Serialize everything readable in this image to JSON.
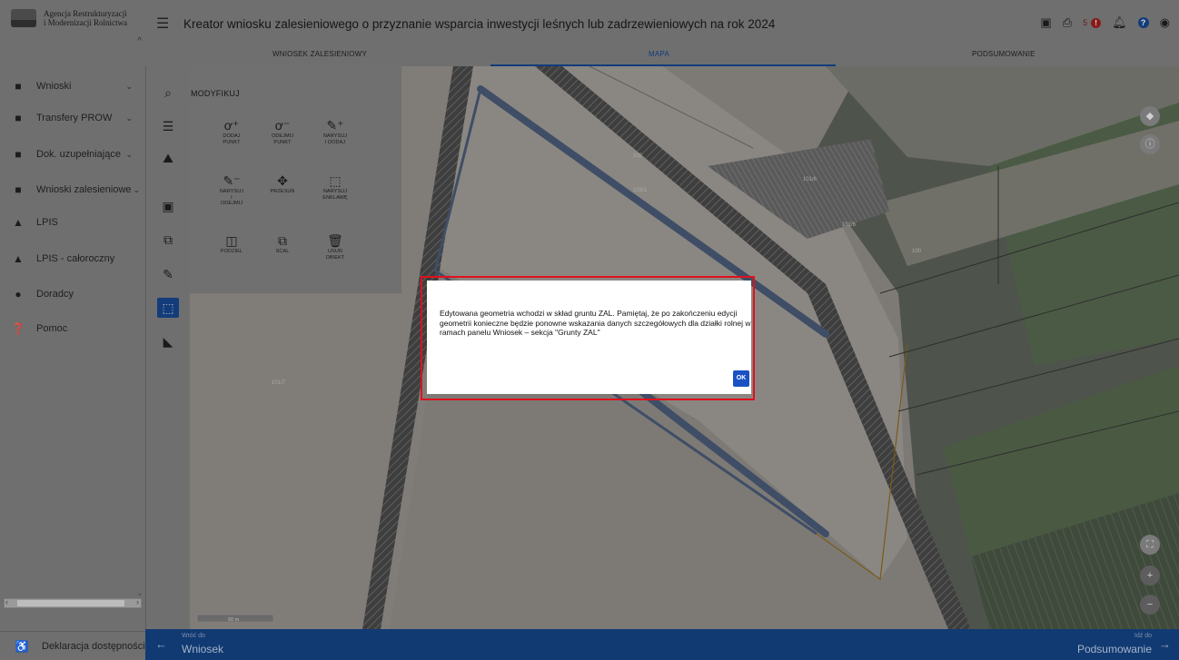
{
  "app": {
    "logo_text_line1": "Agencja Restrukturyzacji",
    "logo_text_line2": "i Modernizacji Rolnictwa",
    "title": "Kreator wniosku zalesieniowego o przyznanie wsparcia inwestycji leśnych lub zadrzewieniowych na rok  2024"
  },
  "header": {
    "save_icon": "save-icon",
    "print_icon": "print-icon",
    "notification_count": "5",
    "alert_badge": "!",
    "bell_icon": "bell-icon",
    "help_badge": "?",
    "account_icon": "account-icon"
  },
  "tabs": [
    {
      "label": "WNIOSEK ZALESIENIOWY"
    },
    {
      "label": "MAPA"
    },
    {
      "label": "PODSUMOWANIE"
    }
  ],
  "sidebar": {
    "items": [
      {
        "label": "Wnioski",
        "icon": "document-icon",
        "has_chevron": true
      },
      {
        "label": "Transfery PROW",
        "icon": "document-icon",
        "has_chevron": true
      },
      {
        "label": "Dok. uzupełniające",
        "icon": "document-icon",
        "has_chevron": true
      },
      {
        "label": "Wnioski zalesieniowe",
        "icon": "document-icon",
        "has_chevron": true
      },
      {
        "label": "LPIS",
        "icon": "mountain-icon",
        "has_chevron": false
      },
      {
        "label": "LPIS - całoroczny",
        "icon": "mountain-icon",
        "has_chevron": false
      },
      {
        "label": "Doradcy",
        "icon": "person-icon",
        "has_chevron": false
      },
      {
        "label": "Pomoc",
        "icon": "help-icon",
        "has_chevron": false
      }
    ],
    "accessibility_label": "Deklaracja dostępności"
  },
  "modify_panel": {
    "title": "MODYFIKUJ",
    "tools": [
      {
        "label": "DODAJ\nPUNKT",
        "icon": "add-point-icon"
      },
      {
        "label": "ODEJMIJ\nPUNKT",
        "icon": "remove-point-icon"
      },
      {
        "label": "NARYSUJ\nI DODAJ",
        "icon": "draw-add-icon"
      },
      {
        "label": "NARYSUJ\nI\nODEJMIJ",
        "icon": "draw-subtract-icon"
      },
      {
        "label": "PRZESUŃ",
        "icon": "move-icon"
      },
      {
        "label": "NARYSUJ\nENKLAWĘ",
        "icon": "draw-enclave-icon"
      },
      {
        "label": "PODZIEL",
        "icon": "split-icon"
      },
      {
        "label": "SCAL",
        "icon": "merge-icon"
      },
      {
        "label": "USUŃ\nOBIEKT",
        "icon": "delete-icon"
      }
    ]
  },
  "map": {
    "parcel_labels": [
      "101/6",
      "101/6",
      "100",
      "103/1",
      "101/7",
      "102"
    ],
    "scale_label": "50 m"
  },
  "bottom_nav": {
    "back_small": "Wróć do",
    "back_big": "Wniosek",
    "next_small": "Idź do",
    "next_big": "Podsumowanie"
  },
  "modal": {
    "message": "Edytowana geometria wchodzi w skład gruntu ZAL. Pamiętaj, że po zakończeniu edycji geometrii konieczne będzie ponowne wskazania danych szczegółowych dla działki rolnej w ramach panelu Wniosek – sekcja \"Grunty ZAL\"",
    "ok_label": "OK"
  },
  "colors": {
    "primary": "#123c7a",
    "ok_button": "#1a52c4",
    "highlight_frame": "#e0101d"
  }
}
